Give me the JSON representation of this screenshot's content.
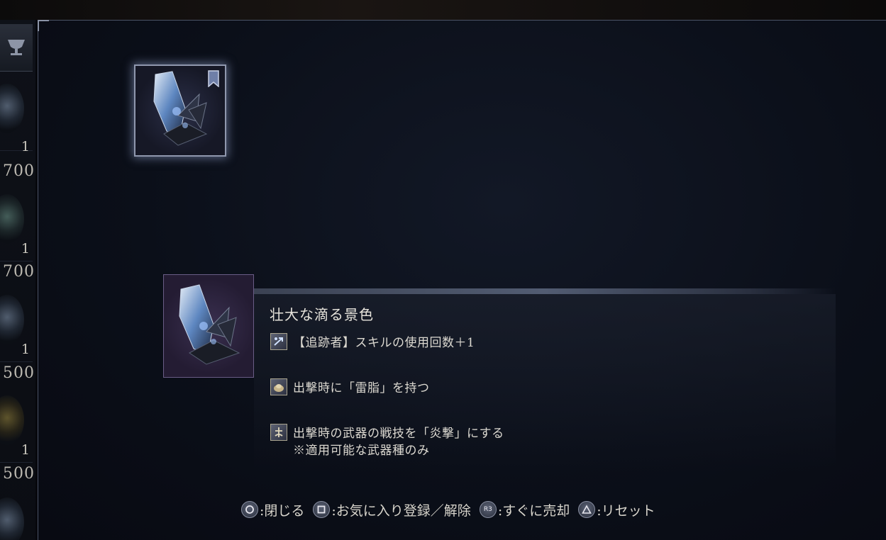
{
  "inventory": {
    "counts": [
      "1",
      "1",
      "1",
      "1"
    ],
    "prices": [
      "700",
      "700",
      "500",
      "500"
    ]
  },
  "detail": {
    "name": "壮大な滴る景色",
    "effects": [
      {
        "icon": "pursuer-skill-icon",
        "lines": [
          "【追跡者】スキルの使用回数＋1"
        ]
      },
      {
        "icon": "thunder-resin-icon",
        "lines": [
          "出撃時に「雷脂」を持つ"
        ]
      },
      {
        "icon": "weapon-skill-icon",
        "lines": [
          "出撃時の武器の戦技を「炎撃」にする",
          "※適用可能な武器種のみ"
        ]
      }
    ]
  },
  "footer": {
    "close": ":閉じる",
    "favorite": ":お気に入り登録／解除",
    "sell_glyph": "R3",
    "sell": ":すぐに売却",
    "reset": ":リセット"
  },
  "colors": {
    "panel_bg": "#0b0f19",
    "accent_glow": "#8f97ad",
    "thumb_border": "#6a5d86"
  }
}
